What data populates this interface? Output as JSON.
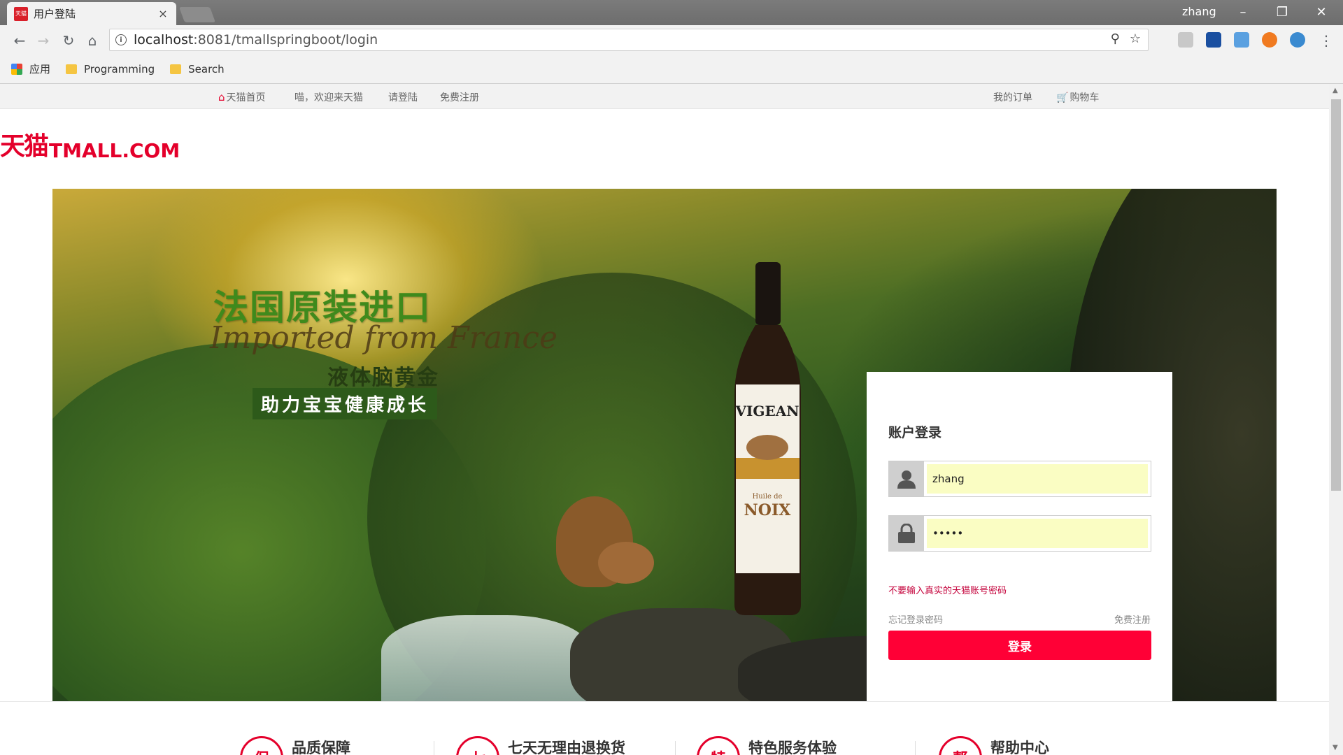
{
  "browser": {
    "tab_title": "用户登陆",
    "tab_close": "×",
    "favicon_text": "天猫",
    "profile_name": "zhang",
    "url_host": "localhost",
    "url_path": ":8081/tmallspringboot/login",
    "bookmarks": [
      {
        "label": "应用",
        "icon": "apps-icon"
      },
      {
        "label": "Programming",
        "icon": "folder-icon"
      },
      {
        "label": "Search",
        "icon": "folder-icon"
      }
    ]
  },
  "topnav": {
    "home": "天猫首页",
    "welcome": "喵，欢迎来天猫",
    "login": "请登陆",
    "register": "免费注册",
    "orders": "我的订单",
    "cart": "购物车"
  },
  "logo": {
    "cn": "天猫",
    "en": "TMALL.COM"
  },
  "banner": {
    "headline": "法国原装进口",
    "script": "Imported from France",
    "subheadline": "液体脑黄金",
    "tagline": "助力宝宝健康成长",
    "bottle_brand": "VIGEAN",
    "bottle_product": "Huile de",
    "bottle_name": "NOIX"
  },
  "login": {
    "title": "账户登录",
    "username_value": "zhang",
    "password_value": "•••••",
    "warning": "不要输入真实的天猫账号密码",
    "forgot": "忘记登录密码",
    "register": "免费注册",
    "submit": "登录"
  },
  "services": [
    {
      "glyph": "保",
      "label": "品质保障"
    },
    {
      "glyph": "七",
      "label": "七天无理由退换货"
    },
    {
      "glyph": "特",
      "label": "特色服务体验"
    },
    {
      "glyph": "帮",
      "label": "帮助中心"
    }
  ],
  "colors": {
    "accent": "#ff0036",
    "brand": "#e4002b",
    "autofill": "#fafdc3"
  }
}
